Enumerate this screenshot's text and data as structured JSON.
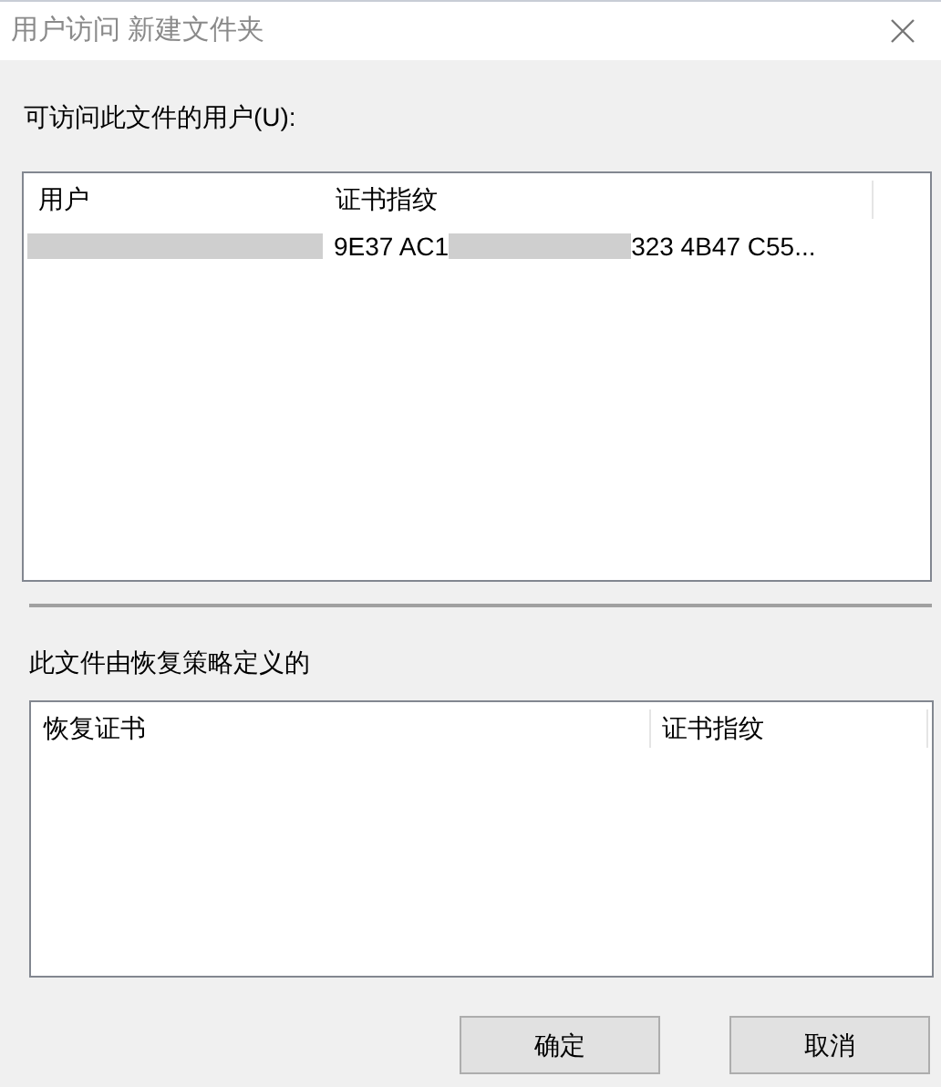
{
  "window": {
    "title": "用户访问 新建文件夹"
  },
  "users_list": {
    "label": "可访问此文件的用户(U):",
    "columns": [
      "用户",
      "证书指纹"
    ],
    "rows": [
      {
        "user_redacted": true,
        "thumbprint_start": "9E37 AC1",
        "thumbprint_redacted": true,
        "thumbprint_end": "323 4B47 C55..."
      }
    ]
  },
  "recovery_list": {
    "label": "此文件由恢复策略定义的",
    "columns": [
      "恢复证书",
      "证书指纹"
    ]
  },
  "buttons": [
    "确定",
    "取消"
  ]
}
